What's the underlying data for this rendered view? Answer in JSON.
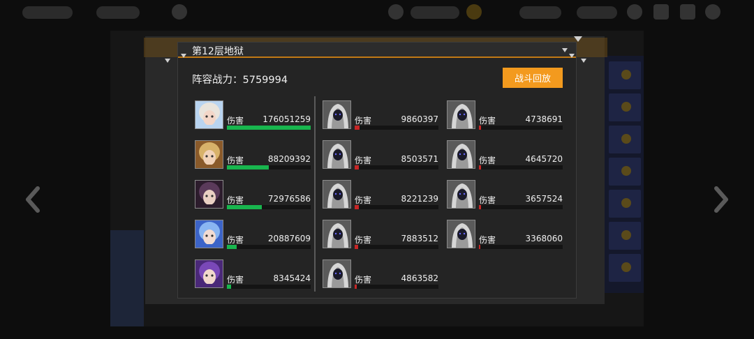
{
  "colors": {
    "accent_orange": "#f39a1e",
    "hero_bar": "#18b64e",
    "enemy_bar": "#c62626"
  },
  "modal": {
    "title": "第12层地狱",
    "team_power": "阵容战力：5759994",
    "replay_button": "战斗回放"
  },
  "heroes": [
    {
      "label": "伤害",
      "damage": "176051259",
      "fill": 1.0
    },
    {
      "label": "伤害",
      "damage": "88209392",
      "fill": 0.501
    },
    {
      "label": "伤害",
      "damage": "72976586",
      "fill": 0.415
    },
    {
      "label": "伤害",
      "damage": "20887609",
      "fill": 0.119
    },
    {
      "label": "伤害",
      "damage": "8345424",
      "fill": 0.047
    }
  ],
  "enemies_col1": [
    {
      "label": "伤害",
      "damage": "9860397",
      "fill": 0.056
    },
    {
      "label": "伤害",
      "damage": "8503571",
      "fill": 0.048
    },
    {
      "label": "伤害",
      "damage": "8221239",
      "fill": 0.047
    },
    {
      "label": "伤害",
      "damage": "7883512",
      "fill": 0.045
    },
    {
      "label": "伤害",
      "damage": "4863582",
      "fill": 0.028
    }
  ],
  "enemies_col2": [
    {
      "label": "伤害",
      "damage": "4738691",
      "fill": 0.027
    },
    {
      "label": "伤害",
      "damage": "4645720",
      "fill": 0.026
    },
    {
      "label": "伤害",
      "damage": "3657524",
      "fill": 0.021
    },
    {
      "label": "伤害",
      "damage": "3368060",
      "fill": 0.019
    }
  ],
  "icons": {
    "prev": "chevron-left-icon",
    "next": "chevron-right-icon",
    "hero_avatar": "hero-portrait-icon",
    "enemy_avatar": "hooded-enemy-icon"
  }
}
